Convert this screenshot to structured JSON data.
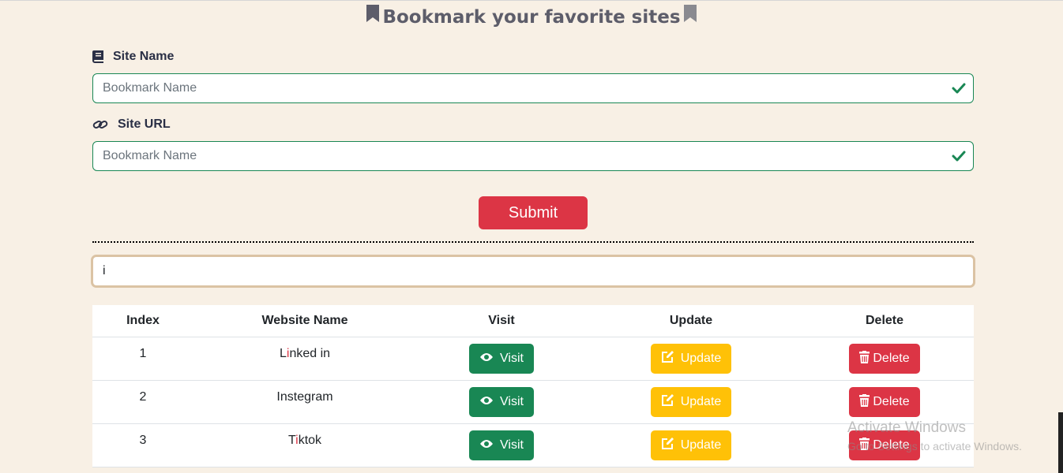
{
  "header": {
    "title": "Bookmark your favorite sites",
    "title_color": "#5d5d6a"
  },
  "form": {
    "site_name": {
      "label": "Site Name",
      "icon": "book-icon",
      "placeholder": "Bookmark Name",
      "value": "",
      "valid": true
    },
    "site_url": {
      "label": "Site URL",
      "icon": "link-icon",
      "placeholder": "Bookmark Name",
      "value": "",
      "valid": true
    },
    "submit_label": "Submit"
  },
  "search": {
    "value": "i",
    "placeholder": ""
  },
  "table": {
    "headers": [
      "Index",
      "Website Name",
      "Visit",
      "Update",
      "Delete"
    ],
    "rows": [
      {
        "index": "1",
        "name_pre": "L",
        "name_hl": "i",
        "name_post": "nked in",
        "visit": "Visit",
        "update": "Update",
        "delete": "Delete"
      },
      {
        "index": "2",
        "name_pre": "Instegram",
        "name_hl": "",
        "name_post": "",
        "visit": "Visit",
        "update": "Update",
        "delete": "Delete"
      },
      {
        "index": "3",
        "name_pre": "T",
        "name_hl": "i",
        "name_post": "ktok",
        "visit": "Visit",
        "update": "Update",
        "delete": "Delete"
      }
    ]
  },
  "watermark": {
    "title": "Activate Windows",
    "subtitle": "Go to Settings to activate Windows."
  },
  "colors": {
    "background": "#f8f0e5",
    "success": "#198754",
    "warning": "#ffc107",
    "danger": "#dc3545",
    "search_border": "#dbc3a4"
  }
}
